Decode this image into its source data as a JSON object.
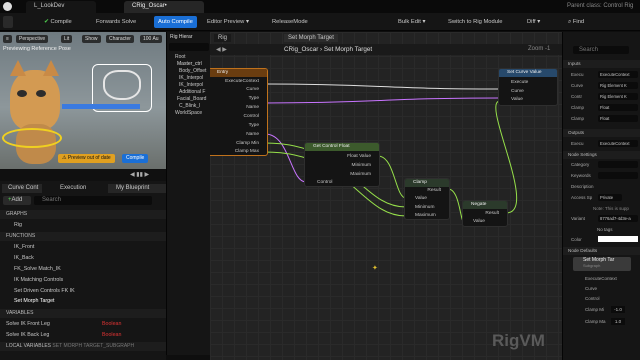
{
  "tabs": {
    "lookdev": "L_LookDev",
    "rig": "CRig_Oscar•",
    "parent_class": "Parent class: Control Rig"
  },
  "toolbar": {
    "compile": "Compile",
    "forwards_solve": "Forwards Solve",
    "auto_compile": "Auto Compile",
    "editor_preview": "Editor Preview",
    "release_mode": "ReleaseMode",
    "bulk_edit": "Bulk Edit",
    "switch_rig_module": "Switch to Rig Module",
    "diff": "Diff",
    "find": "Find"
  },
  "viewport": {
    "perspective": "Perspective",
    "lit": "Lit",
    "show": "Show",
    "character": "Character",
    "zoom": "100 Au",
    "preview_text": "Previewing Reference Pose",
    "preview_btn": "Preview out of date",
    "compile_btn": "Compile"
  },
  "hierarchy": {
    "tab": "Rig Hierar",
    "items": [
      "Root",
      "Master_ctrl",
      "Body_Offset",
      "IK_Interpol",
      "IK_Interpol",
      "Additional F",
      "Facial_Board",
      "C_Blink_l",
      "WorldSpace"
    ]
  },
  "left": {
    "tabs": [
      "Curve Cont",
      "Execution",
      "My Blueprint"
    ],
    "add": "Add",
    "search": "Search",
    "graphs": "GRAPHS",
    "rig": "Rig",
    "functions": "FUNCTIONS",
    "functions_list": [
      "IK_Front",
      "IK_Back",
      "FK_Solve Match_IK",
      "IK Matching Controls",
      "Set Driven Controls FK IK",
      "Set Morph Target"
    ],
    "variables": "VARIABLES",
    "vars": [
      {
        "name": "Solve IK Front Leg",
        "type": "Boolean"
      },
      {
        "name": "Solve IK Back Leg",
        "type": "Boolean"
      }
    ],
    "local": "LOCAL VARIABLES",
    "local_sub": "SET MORPH TARGET_SUBGRAPH"
  },
  "graph": {
    "tab": "Rig",
    "tab2": "Set Morph Target",
    "bc1": "CRig_Oscar",
    "bc2": "Set Morph Target",
    "zoom": "Zoom -1",
    "watermark": "RigVM",
    "entry": {
      "title": "Entry",
      "pins": [
        "ExecuteContext",
        "Curve",
        "Type",
        "Name",
        "Control",
        "Type",
        "Name",
        "Clamp Min",
        "Clamp Max"
      ]
    },
    "set_curve": {
      "title": "Set Curve Value",
      "pins": [
        "Execute",
        "Curve",
        "Value"
      ]
    },
    "get_control": {
      "title": "Get Control Float",
      "pins": [
        "Float Value",
        "Minimum",
        "Maximum",
        "Control"
      ]
    },
    "clamp": {
      "title": "Clamp",
      "pins": [
        "Result",
        "Value",
        "Minimum",
        "Maximum"
      ]
    },
    "negate": {
      "title": "Negate",
      "pins": [
        "Result",
        "Value"
      ]
    }
  },
  "details": {
    "search": "Search",
    "inputs": "Inputs",
    "inputs_list": [
      [
        "Execu",
        "ExecuteContext"
      ],
      [
        "Curve",
        "Rig Element K"
      ],
      [
        "Contr",
        "Rig Element K"
      ],
      [
        "Clamp",
        "Float"
      ],
      [
        "Clamp",
        "Float"
      ]
    ],
    "outputs": "Outputs",
    "out_row": [
      "Execu",
      "ExecuteContext"
    ],
    "node_settings": "Node Settings",
    "category": "Category",
    "keywords": "Keywords",
    "description": "Description",
    "access": "Access Sp",
    "access_val": "Private",
    "note": "Note: This is supp",
    "variant": "Variant",
    "variant_val": "8776ad7-4d3e-a",
    "no_tags": "No tags",
    "color": "Color",
    "node_defaults": "Node Defaults",
    "preview_title": "Set Morph Tar",
    "preview_sub": "Subgraph",
    "defaults_pins": [
      "ExecuteContext",
      "Curve",
      "Control",
      "Clamp Mi",
      "Clamp Ma"
    ],
    "clamp_min": "-1.0",
    "clamp_max": "1.0"
  },
  "colors": {
    "accent": "#1a6fd6",
    "exec": "#ffffff",
    "float": "#96e04a",
    "element": "#3a82ff",
    "name": "#c874ff"
  }
}
